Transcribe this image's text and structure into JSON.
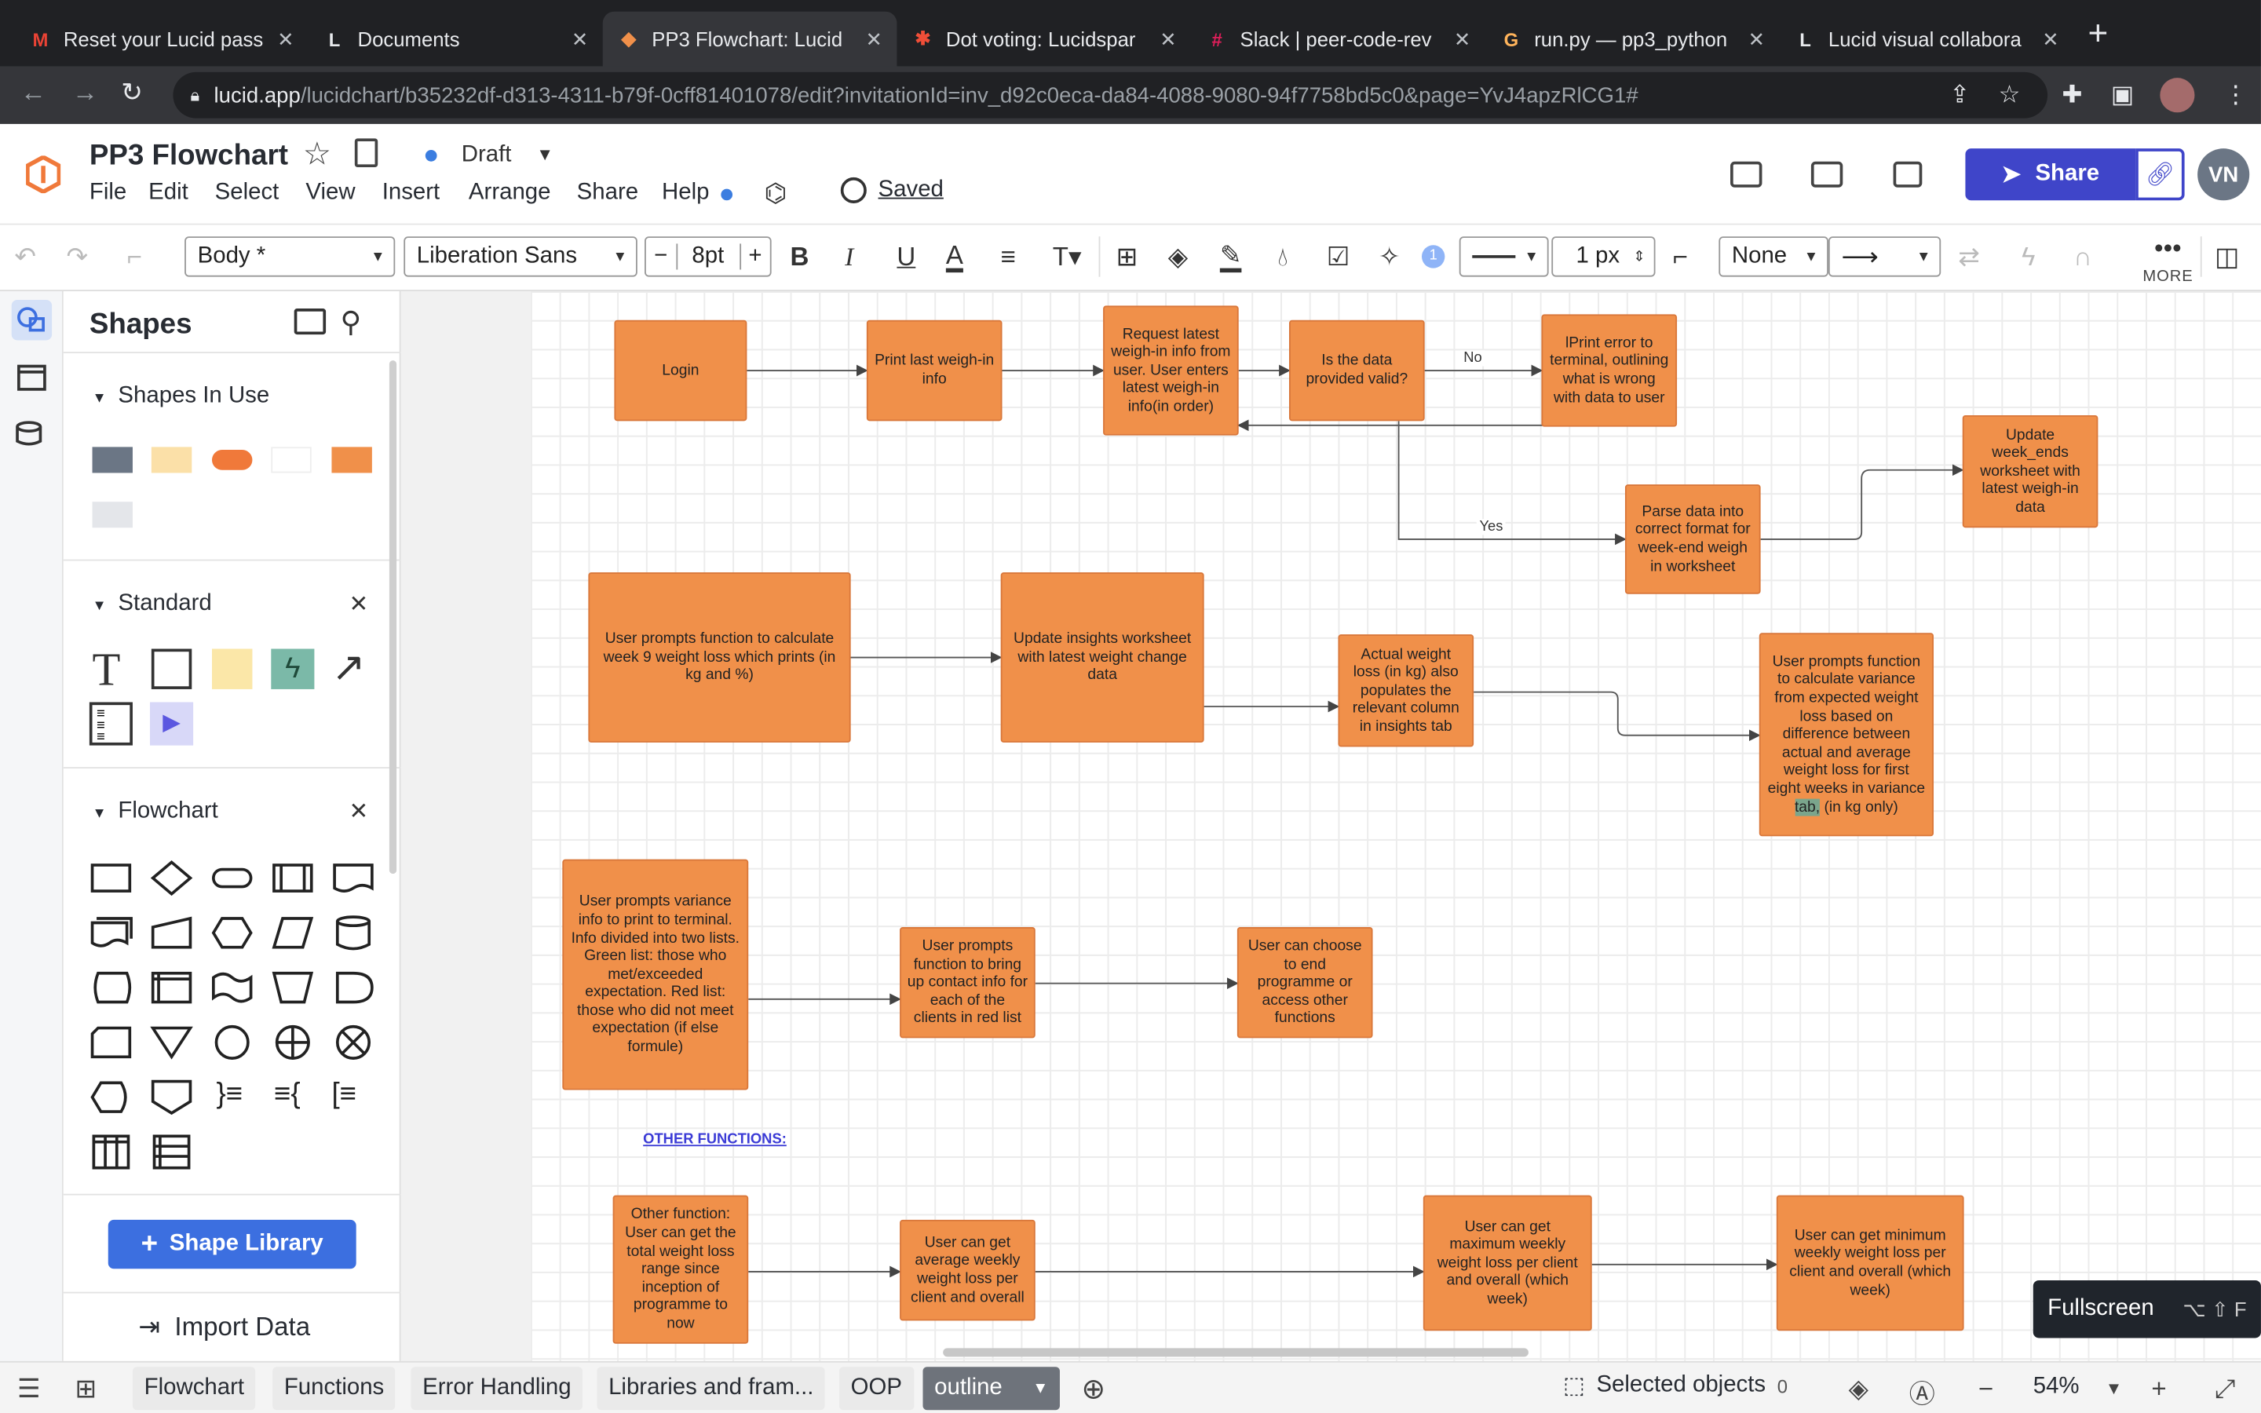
{
  "browser": {
    "tabs": [
      {
        "title": "Reset your Lucid pass",
        "icon": "gmail-icon",
        "color": "#ea4335",
        "glyph": "M"
      },
      {
        "title": "Documents",
        "icon": "lucid-icon",
        "color": "#ffffff",
        "glyph": "L"
      },
      {
        "title": "PP3 Flowchart: Lucid",
        "icon": "lucid-orange-icon",
        "color": "#f0904a",
        "glyph": "◆"
      },
      {
        "title": "Dot voting: Lucidspar",
        "icon": "lucidspark-icon",
        "color": "#f04e38",
        "glyph": "✱"
      },
      {
        "title": "Slack | peer-code-rev",
        "icon": "slack-icon",
        "color": "#e01e5a",
        "glyph": "#"
      },
      {
        "title": "run.py — pp3_python",
        "icon": "gitpod-icon",
        "color": "#ffb45b",
        "glyph": "G"
      },
      {
        "title": "Lucid visual collabora",
        "icon": "lucid-icon",
        "color": "#ffffff",
        "glyph": "L"
      }
    ],
    "url_host": "lucid.app",
    "url_path": "/lucidchart/b35232df-d313-4311-b79f-0cff81401078/edit?invitationId=inv_d92c0eca-da84-4088-9080-94f7758bd5c0&page=YvJ4apzRlCG1#"
  },
  "header": {
    "doc_title": "PP3 Flowchart",
    "status": "Draft",
    "menu": [
      "File",
      "Edit",
      "Select",
      "View",
      "Insert",
      "Arrange",
      "Share",
      "Help"
    ],
    "saved": "Saved",
    "share": "Share",
    "avatar": "VN"
  },
  "toolbar": {
    "style": "Body *",
    "font": "Liberation Sans",
    "font_size": "8",
    "font_unit": "pt",
    "line_width": "1 px",
    "arrow_start": "None",
    "badge": "1",
    "more": "MORE"
  },
  "panel": {
    "title": "Shapes",
    "sections": {
      "in_use": "Shapes In Use",
      "standard": "Standard",
      "flowchart": "Flowchart"
    },
    "in_use_colors": [
      "#6b7685",
      "#fbe0a8",
      "#f0904a",
      "#ffffff",
      "#f0904a",
      "#e4e6ea"
    ],
    "shape_library": "Shape Library",
    "import_data": "Import Data"
  },
  "diagram": {
    "nodes": [
      {
        "id": "login",
        "text": "Login"
      },
      {
        "id": "print_last",
        "text": "Print last weigh-in info"
      },
      {
        "id": "request",
        "text": "Request latest weigh-in info from user. User enters latest weigh-in info(in order)"
      },
      {
        "id": "valid",
        "text": "Is the data provided valid?"
      },
      {
        "id": "error",
        "text": "lPrint error to terminal, outlining what is wrong with data to user"
      },
      {
        "id": "parse",
        "text": "Parse data into correct format for week-end weigh in worksheet"
      },
      {
        "id": "update_week",
        "text": "Update week_ends worksheet with latest weigh-in data"
      },
      {
        "id": "calc9",
        "text": "User prompts function to calculate week 9 weight loss which prints (in kg and %)"
      },
      {
        "id": "insights",
        "text": "Update insights worksheet with latest weight change data"
      },
      {
        "id": "actual",
        "text": "Actual weight loss (in kg) also populates the relevant column in insights tab"
      },
      {
        "id": "variance_calc",
        "text_before": "User prompts function to calculate variance from expected weight loss based on difference between actual and average weight loss for first eight weeks in variance ",
        "highlight": "tab,",
        "text_after": " (in kg only)"
      },
      {
        "id": "variance_print",
        "text": "User prompts variance info to print to terminal. Info divided into two lists. Green list: those who met/exceeded expectation. Red list: those who did not meet expectation (if else formule)"
      },
      {
        "id": "contact",
        "text": "User prompts function to bring up contact info for each of the clients in red list"
      },
      {
        "id": "end",
        "text": "User can choose to end programme or access other functions"
      },
      {
        "id": "total",
        "text": "Other function: User can get the total weight loss range since inception of programme to now"
      },
      {
        "id": "avg",
        "text": "User can get average weekly weight loss per client and overall"
      },
      {
        "id": "max",
        "text": "User can get maximum weekly weight loss per client and overall (which week)"
      },
      {
        "id": "min",
        "text": "User can get minimum weekly weight loss per client and overall (which week)"
      }
    ],
    "edge_labels": {
      "no": "No",
      "yes": "Yes"
    },
    "section_label": "OTHER FUNCTIONS:"
  },
  "tooltip": {
    "text": "Fullscreen",
    "shortcut": "⌥ ⇧ F"
  },
  "bottom": {
    "pages": [
      "Flowchart",
      "Functions",
      "Error Handling",
      "Libraries and fram...",
      "OOP",
      "outline"
    ],
    "active_page": "outline",
    "selected_label": "Selected objects",
    "selected_count": "0",
    "zoom": "54%"
  }
}
